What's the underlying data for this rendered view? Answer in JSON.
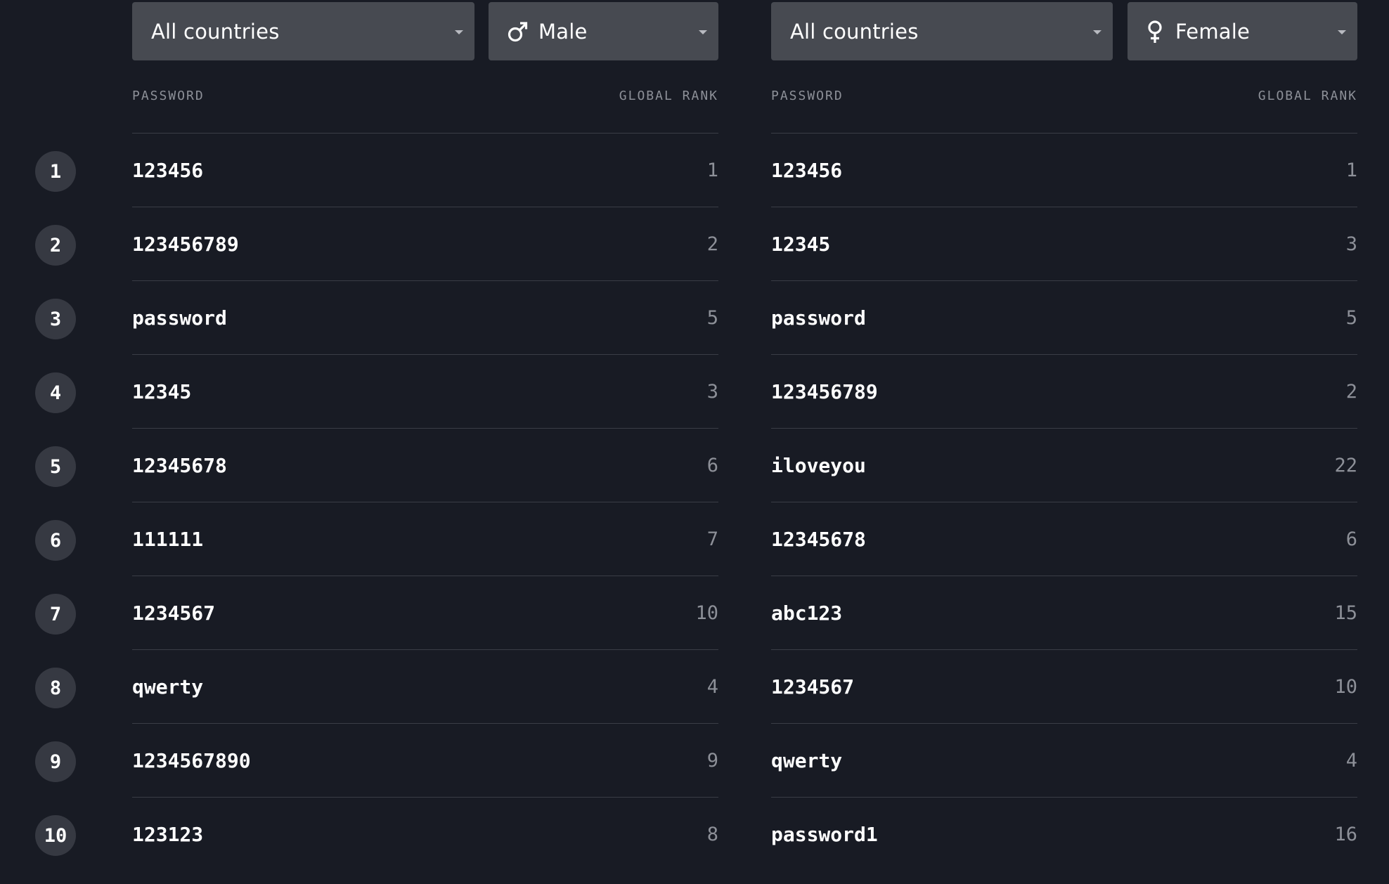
{
  "left": {
    "country_filter": "All countries",
    "gender_filter": "Male",
    "gender_icon": "male-icon",
    "headers": {
      "password": "PASSWORD",
      "rank": "GLOBAL RANK"
    },
    "rows": [
      {
        "password": "123456",
        "rank": "1"
      },
      {
        "password": "123456789",
        "rank": "2"
      },
      {
        "password": "password",
        "rank": "5"
      },
      {
        "password": "12345",
        "rank": "3"
      },
      {
        "password": "12345678",
        "rank": "6"
      },
      {
        "password": "111111",
        "rank": "7"
      },
      {
        "password": "1234567",
        "rank": "10"
      },
      {
        "password": "qwerty",
        "rank": "4"
      },
      {
        "password": "1234567890",
        "rank": "9"
      },
      {
        "password": "123123",
        "rank": "8"
      }
    ]
  },
  "right": {
    "country_filter": "All countries",
    "gender_filter": "Female",
    "gender_icon": "female-icon",
    "headers": {
      "password": "PASSWORD",
      "rank": "GLOBAL RANK"
    },
    "rows": [
      {
        "password": "123456",
        "rank": "1"
      },
      {
        "password": "12345",
        "rank": "3"
      },
      {
        "password": "password",
        "rank": "5"
      },
      {
        "password": "123456789",
        "rank": "2"
      },
      {
        "password": "iloveyou",
        "rank": "22"
      },
      {
        "password": "12345678",
        "rank": "6"
      },
      {
        "password": "abc123",
        "rank": "15"
      },
      {
        "password": "1234567",
        "rank": "10"
      },
      {
        "password": "qwerty",
        "rank": "4"
      },
      {
        "password": "password1",
        "rank": "16"
      }
    ]
  },
  "positions": [
    "1",
    "2",
    "3",
    "4",
    "5",
    "6",
    "7",
    "8",
    "9",
    "10"
  ],
  "colors": {
    "background": "#181b24",
    "dropdown": "#474a51",
    "badge": "#363942",
    "divider": "#3a3d46",
    "muted_text": "#8d9098"
  }
}
